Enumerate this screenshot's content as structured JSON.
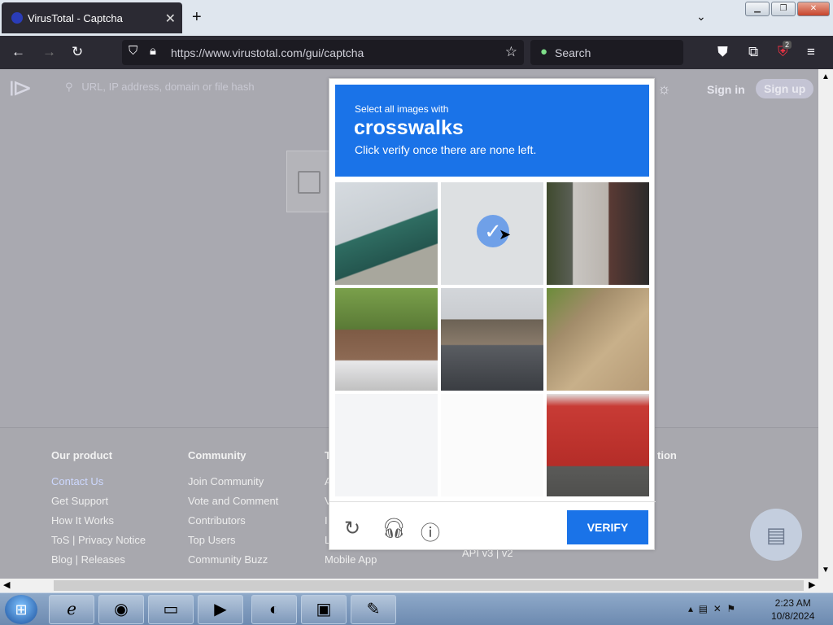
{
  "browser": {
    "tab_title": "VirusTotal - Captcha",
    "url": "https://www.virustotal.com/gui/captcha",
    "search_placeholder": "Search",
    "extension_badge": "2"
  },
  "site": {
    "search_placeholder": "URL, IP address, domain or file hash",
    "signin": "Sign in",
    "signup": "Sign up"
  },
  "footer": {
    "col1": {
      "heading": "Our product",
      "items": [
        "Contact Us",
        "Get Support",
        "How It Works",
        "ToS | Privacy Notice",
        "Blog | Releases"
      ]
    },
    "col2": {
      "heading": "Community",
      "items": [
        "Join Community",
        "Vote and Comment",
        "Contributors",
        "Top Users",
        "Community Buzz"
      ]
    },
    "col3": {
      "heading": "T",
      "items": [
        "A",
        "V",
        "I",
        "L",
        "Mobile App"
      ]
    },
    "col4": {
      "heading": "tion",
      "items": [
        "API v3 | v2"
      ]
    }
  },
  "captcha": {
    "prompt_line1": "Select all images with",
    "target": "crosswalks",
    "prompt_line3": "Click verify once there are none left.",
    "verify_label": "VERIFY",
    "tiles": [
      {
        "selected": false
      },
      {
        "selected": true
      },
      {
        "selected": false
      },
      {
        "selected": false
      },
      {
        "selected": false
      },
      {
        "selected": false
      },
      {
        "selected": false
      },
      {
        "selected": false
      },
      {
        "selected": false
      }
    ]
  },
  "taskbar": {
    "time": "2:23 AM",
    "date": "10/8/2024"
  }
}
